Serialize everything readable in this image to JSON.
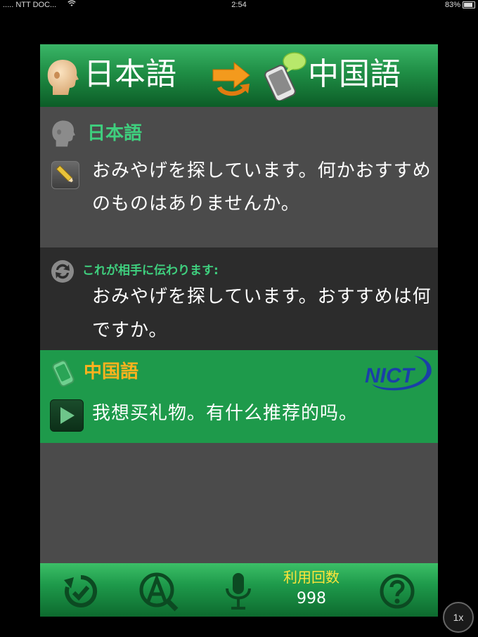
{
  "status_bar": {
    "carrier": "..... NTT DOC...",
    "time": "2:54",
    "battery_text": "83%",
    "battery_level": 0.83
  },
  "header": {
    "source_language": "日本語",
    "target_language": "中国語"
  },
  "source_panel": {
    "label": "日本語",
    "text": "おみやげを探しています。何かおすすめのものはありませんか。"
  },
  "back_translation": {
    "label": "これが相手に伝わります:",
    "text": "おみやげを探しています。おすすめは何ですか。"
  },
  "target_panel": {
    "label": "中国語",
    "text": "我想买礼物。有什么推荐的吗。",
    "logo_text": "NICT"
  },
  "toolbar": {
    "count_label": "利用回数",
    "count_value": "998"
  },
  "zoom_badge": "1x",
  "colors": {
    "accent_green": "#1e9a4b",
    "label_green": "#3fcf7e",
    "label_orange": "#ffb21e",
    "count_yellow": "#ffe53a"
  },
  "icons": [
    "wifi-icon",
    "battery-icon",
    "speaker-face-icon",
    "swap-arrow-icon",
    "phone-speech-icon",
    "pencil-icon",
    "refresh-icon",
    "phone-icon",
    "nict-logo",
    "play-icon",
    "history-icon",
    "translate-settings-icon",
    "microphone-icon",
    "help-icon"
  ]
}
